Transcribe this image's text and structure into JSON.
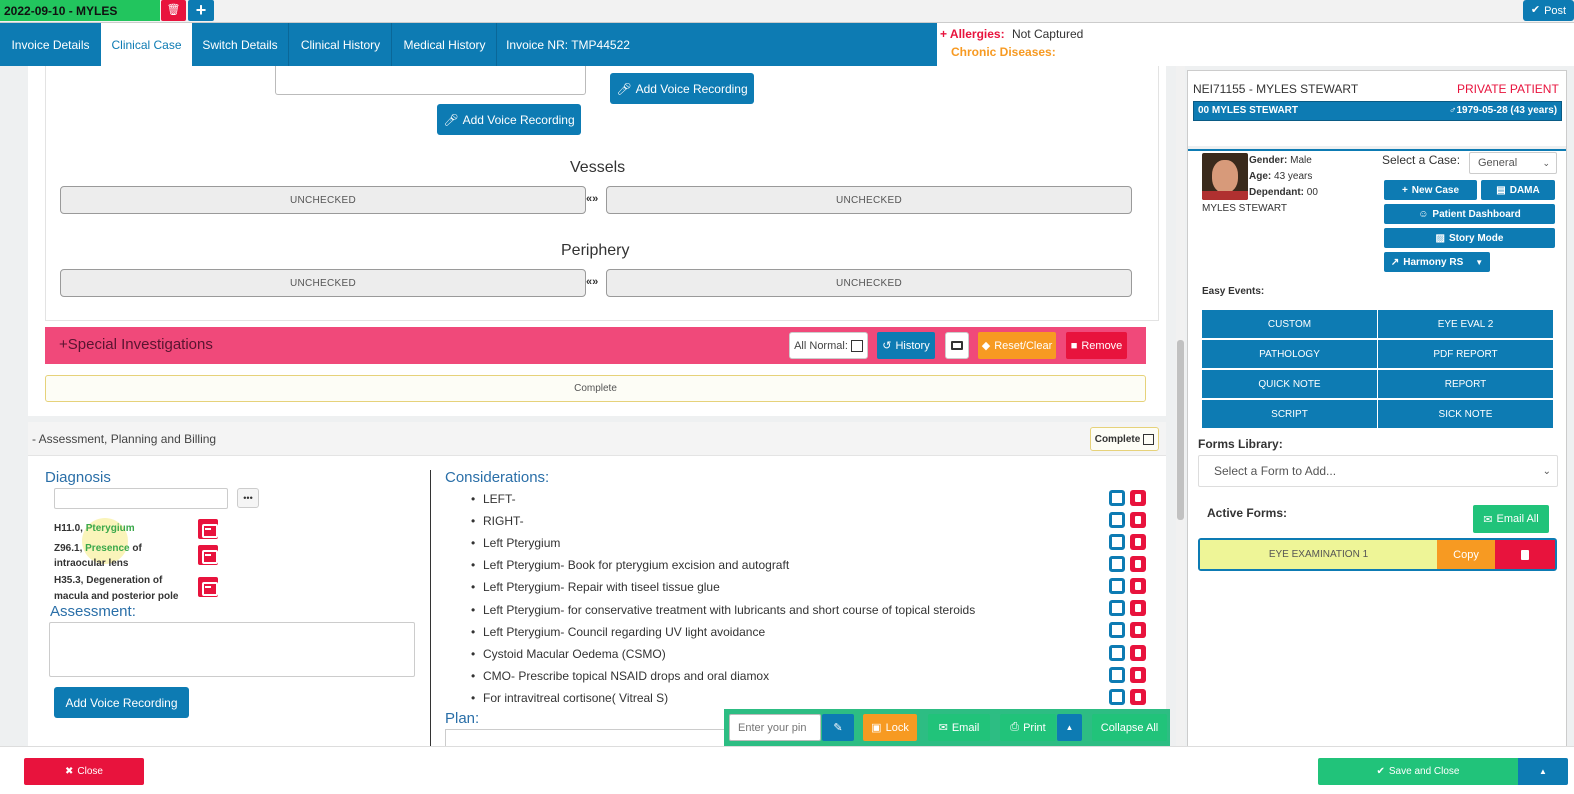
{
  "topbar": {
    "patient_tab": "2022-09-10 - MYLES",
    "post_label": "Post"
  },
  "tabs": [
    "Invoice Details",
    "Clinical Case",
    "Switch Details",
    "Clinical History",
    "Medical History",
    "Invoice NR: TMP44522"
  ],
  "alerts": {
    "allergies_label": "Allergies:",
    "allergies_value": "Not Captured",
    "chronic_label": "Chronic Diseases:"
  },
  "voice": {
    "label1": "Add Voice Recording",
    "label2": "Add Voice Recording",
    "label3": "Add Voice Recording"
  },
  "vessels": {
    "title": "Vessels",
    "left": "UNCHECKED",
    "right": "UNCHECKED",
    "link": "«»"
  },
  "periphery": {
    "title": "Periphery",
    "left": "UNCHECKED",
    "right": "UNCHECKED",
    "link": "«»"
  },
  "special": {
    "title": "+Special Investigations",
    "all_normal": "All Normal:",
    "history": "History",
    "reset": "Reset/Clear",
    "remove": "Remove",
    "complete": "Complete"
  },
  "apb": {
    "title": "Assessment, Planning and Billing",
    "complete": "Complete",
    "prefix": "-"
  },
  "diagnosis": {
    "title": "Diagnosis",
    "dots": "•••",
    "items": [
      {
        "code": "H11.0, ",
        "hl": "Pterygium",
        "rest": "",
        "line2": ""
      },
      {
        "code": "Z96.1, ",
        "hl": "Presence",
        "rest": " of",
        "line2": "intraocular lens"
      },
      {
        "code": "H35.3, Degeneration of",
        "hl": "",
        "rest": "",
        "line2": "macula and posterior pole"
      }
    ]
  },
  "assessment": {
    "title": "Assessment:"
  },
  "considerations": {
    "title": "Considerations:",
    "items": [
      "LEFT-",
      "RIGHT-",
      "Left Pterygium",
      "Left Pterygium- Book for pterygium excision and autograft",
      "Left Pterygium- Repair with tiseel tissue glue",
      "Left Pterygium- for conservative treatment with lubricants and short course of topical steroids",
      "Left Pterygium- Council regarding UV light avoidance",
      "Cystoid Macular Oedema (CSMO)",
      "CMO- Prescribe topical NSAID drops and oral diamox",
      "For intravitreal cortisone( Vitreal S)"
    ]
  },
  "plan": {
    "title": "Plan:"
  },
  "floatbar": {
    "pin_placeholder": "Enter your pin",
    "lock": "Lock",
    "email": "Email",
    "print": "Print",
    "collapse": "Collapse All"
  },
  "patient": {
    "id_line": "NEI71155 - MYLES STEWART",
    "type": "PRIVATE PATIENT",
    "bar_left": "00 MYLES STEWART",
    "bar_right": "1979-05-28 (43 years)",
    "gender_label": "Gender:",
    "gender": "Male",
    "age_label": "Age:",
    "age": "43 years",
    "dep_label": "Dependant:",
    "dep": "00",
    "name": "MYLES STEWART",
    "select_case_label": "Select a Case:",
    "case_value": "General",
    "new_case": "New Case",
    "dama": "DAMA",
    "dashboard": "Patient Dashboard",
    "story": "Story Mode",
    "harmony": "Harmony RS"
  },
  "easy_events": {
    "title": "Easy Events:",
    "buttons": [
      "CUSTOM",
      "EYE EVAL 2",
      "PATHOLOGY",
      "PDF REPORT",
      "QUICK NOTE",
      "REPORT",
      "SCRIPT",
      "SICK NOTE"
    ]
  },
  "forms": {
    "library_label": "Forms Library:",
    "select_placeholder": "Select a Form to Add...",
    "active_label": "Active Forms:",
    "email_all": "Email All",
    "form_name": "EYE EXAMINATION 1",
    "copy": "Copy"
  },
  "footer": {
    "close": "Close",
    "save_close": "Save and Close"
  },
  "colors": {
    "primary": "#0d7bb3",
    "danger": "#e8133d",
    "success": "#21c37a",
    "warning": "#f79a22",
    "special_bar": "#f0497a"
  }
}
